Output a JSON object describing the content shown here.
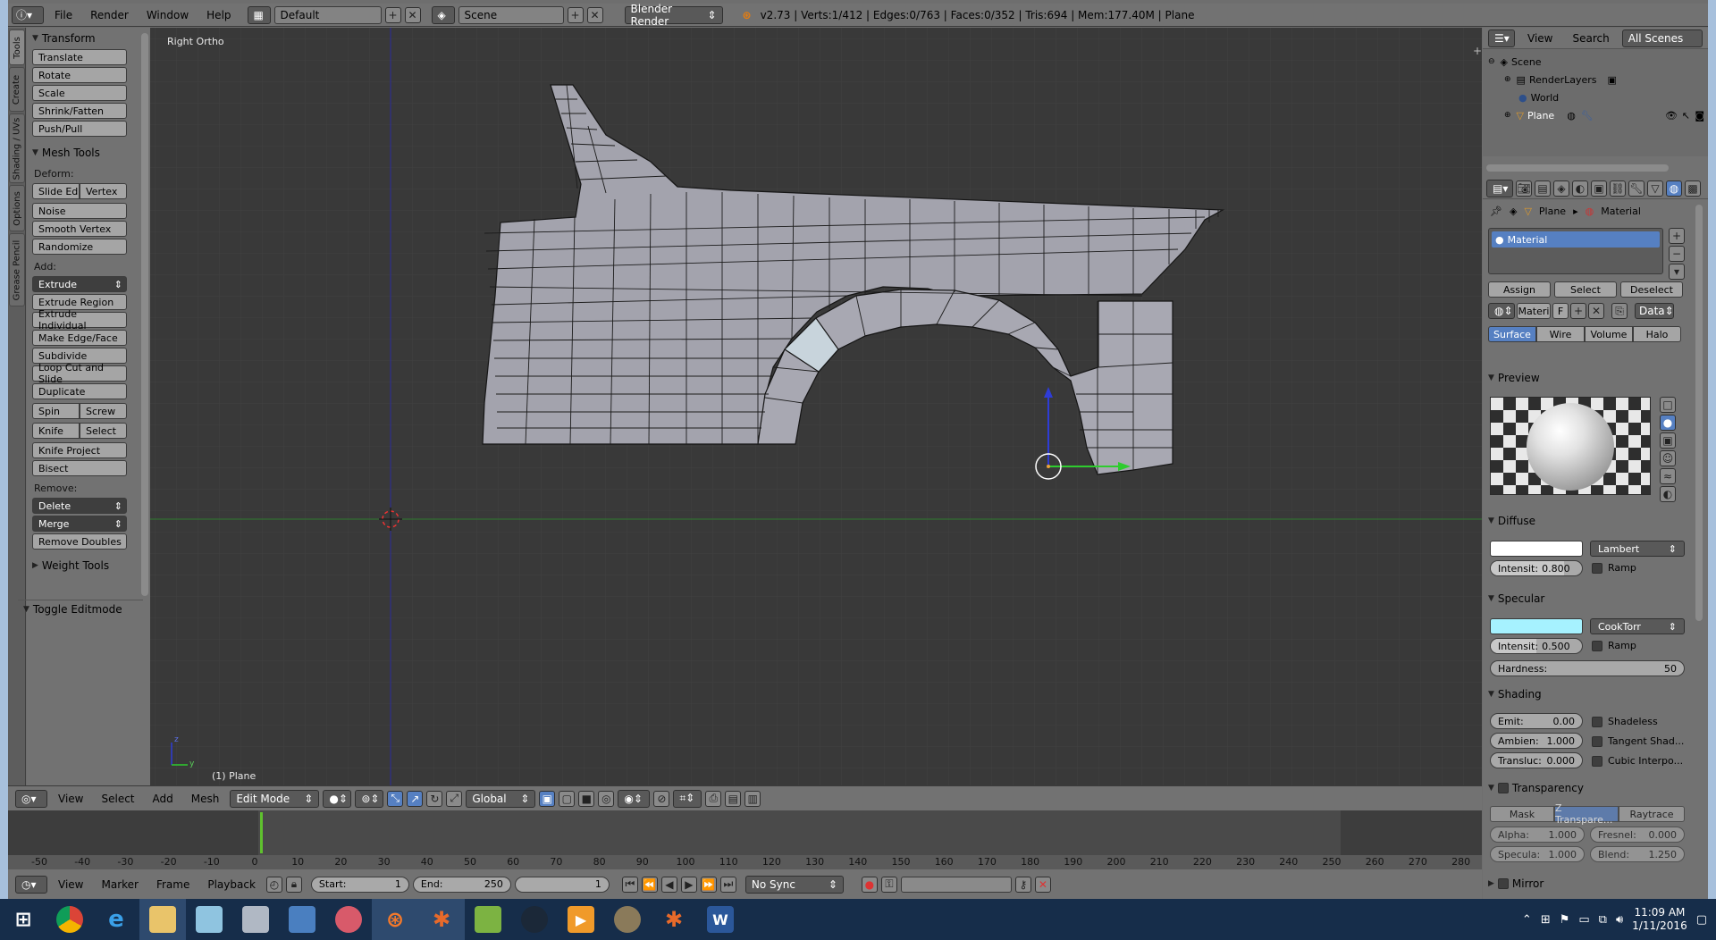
{
  "top_header": {
    "menus": [
      "File",
      "Render",
      "Window",
      "Help"
    ],
    "screen_layout": "Default",
    "scene": "Scene",
    "render_engine": "Blender Render",
    "stats": "v2.73 | Verts:1/412 | Edges:0/763 | Faces:0/352 | Tris:694 | Mem:177.40M | Plane"
  },
  "side_tabs": [
    "Tools",
    "Create",
    "Shading / UVs",
    "Options",
    "Grease Pencil"
  ],
  "tool_shelf": {
    "transform_title": "Transform",
    "transform_buttons": [
      "Translate",
      "Rotate",
      "Scale",
      "Shrink/Fatten",
      "Push/Pull"
    ],
    "mesh_tools_title": "Mesh Tools",
    "deform_label": "Deform:",
    "slide_edge": "Slide Ed",
    "vertex": "Vertex",
    "noise": "Noise",
    "smooth_vertex": "Smooth Vertex",
    "randomize": "Randomize",
    "add_label": "Add:",
    "extrude": "Extrude",
    "extrude_region": "Extrude Region",
    "extrude_individual": "Extrude Individual",
    "make_edge_face": "Make Edge/Face",
    "subdivide": "Subdivide",
    "loop_cut": "Loop Cut and Slide",
    "duplicate": "Duplicate",
    "spin": "Spin",
    "screw": "Screw",
    "knife": "Knife",
    "select": "Select",
    "knife_project": "Knife Project",
    "bisect": "Bisect",
    "remove_label": "Remove:",
    "delete": "Delete",
    "merge": "Merge",
    "remove_doubles": "Remove Doubles",
    "weight_tools": "Weight Tools",
    "toggle_editmode": "Toggle Editmode"
  },
  "viewport": {
    "view_name": "Right Ortho",
    "object_label": "(1) Plane",
    "axis_z": "z",
    "axis_y": "y"
  },
  "viewport_header": {
    "menus": [
      "View",
      "Select",
      "Add",
      "Mesh"
    ],
    "mode": "Edit Mode",
    "orientation": "Global"
  },
  "timeline": {
    "ticks": [
      "-50",
      "-40",
      "-30",
      "-20",
      "-10",
      "0",
      "10",
      "20",
      "30",
      "40",
      "50",
      "60",
      "70",
      "80",
      "90",
      "100",
      "110",
      "120",
      "130",
      "140",
      "150",
      "160",
      "170",
      "180",
      "190",
      "200",
      "210",
      "220",
      "230",
      "240",
      "250",
      "260",
      "270",
      "280"
    ],
    "menus": [
      "View",
      "Marker",
      "Frame",
      "Playback"
    ],
    "start_label": "Start:",
    "start_value": "1",
    "end_label": "End:",
    "end_value": "250",
    "current_frame": "1",
    "sync": "No Sync"
  },
  "outliner": {
    "menus": [
      "View",
      "Search"
    ],
    "filter": "All Scenes",
    "items": [
      "Scene",
      "RenderLayers",
      "World",
      "Plane"
    ]
  },
  "properties": {
    "breadcrumb_object": "Plane",
    "breadcrumb_material": "Material",
    "material_slot": "Material",
    "assign": "Assign",
    "select": "Select",
    "deselect": "Deselect",
    "material_name": "Materi",
    "fake_user": "F",
    "data_link": "Data",
    "tabs": [
      "Surface",
      "Wire",
      "Volume",
      "Halo"
    ],
    "preview_title": "Preview",
    "diffuse_title": "Diffuse",
    "diffuse_shader": "Lambert",
    "diffuse_intensity_label": "Intensit:",
    "diffuse_intensity": "0.800",
    "diffuse_intensity_fraction": 0.8,
    "ramp": "Ramp",
    "specular_title": "Specular",
    "specular_shader": "CookTorr",
    "specular_intensity_label": "Intensit:",
    "specular_intensity": "0.500",
    "specular_intensity_fraction": 0.5,
    "hardness_label": "Hardness:",
    "hardness": "50",
    "shading_title": "Shading",
    "emit_label": "Emit:",
    "emit": "0.00",
    "ambient_label": "Ambien:",
    "ambient": "1.000",
    "translucency_label": "Transluc:",
    "translucency": "0.000",
    "shadeless": "Shadeless",
    "tangent_shading": "Tangent Shad...",
    "cubic_interp": "Cubic Interpo...",
    "transparency_title": "Transparency",
    "transp_tabs": [
      "Mask",
      "Z Transpare...",
      "Raytrace"
    ],
    "alpha_label": "Alpha:",
    "alpha": "1.000",
    "fresnel_label": "Fresnel:",
    "fresnel": "0.000",
    "specular_t_label": "Specula:",
    "specular_t": "1.000",
    "blend_label": "Blend:",
    "blend": "1.250",
    "mirror_title": "Mirror",
    "diffuse_color": "#ffffff",
    "specular_color": "#a6f2ff"
  },
  "taskbar": {
    "time": "11:09 AM",
    "date": "1/11/2016",
    "apps": [
      "start-icon",
      "chrome-icon",
      "ie-icon",
      "explorer-icon",
      "notes-icon",
      "network-icon",
      "people-icon",
      "paint-icon",
      "blender-icon",
      "blender2-icon",
      "chart-icon",
      "steam-icon",
      "media-icon",
      "gimp-icon",
      "blender3-icon",
      "word-icon"
    ]
  }
}
